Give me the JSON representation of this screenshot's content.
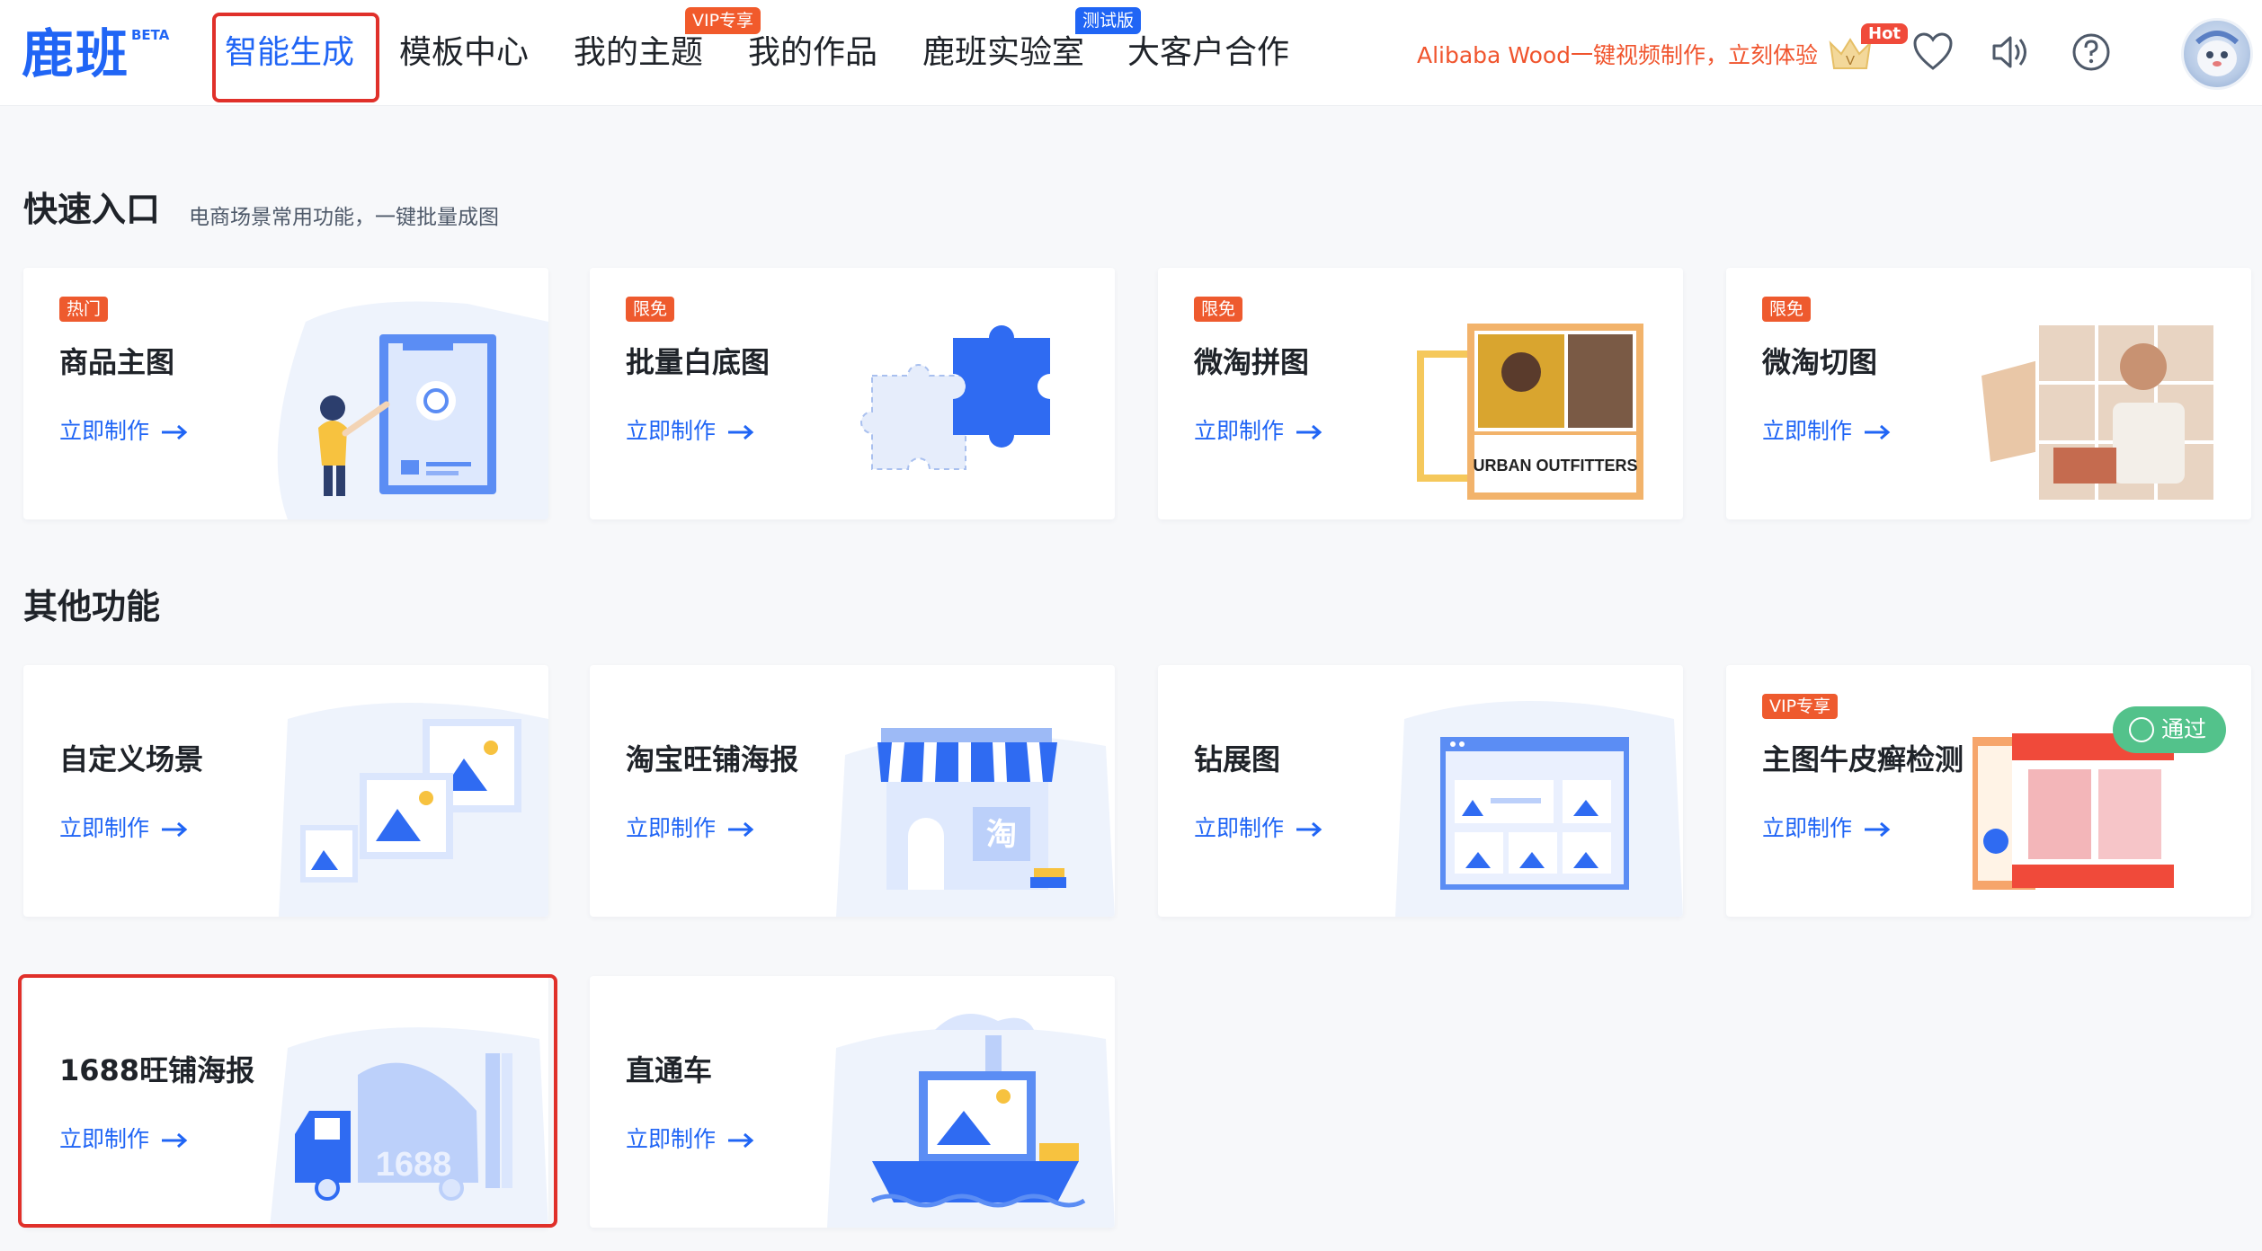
{
  "header": {
    "logo": "鹿班",
    "logo_badge": "BETA",
    "nav": [
      {
        "label": "智能生成",
        "active": true
      },
      {
        "label": "模板中心"
      },
      {
        "label": "我的主题",
        "badge": "VIP专享"
      },
      {
        "label": "我的作品"
      },
      {
        "label": "鹿班实验室",
        "badge": "测试版"
      },
      {
        "label": "大客户合作"
      }
    ],
    "promo": "Alibaba Wood一键视频制作，立刻体验",
    "hot_badge": "Hot",
    "vip_crown_letter": "V",
    "icons": [
      "vip-crown-icon",
      "heart-icon",
      "speaker-icon",
      "help-icon",
      "avatar"
    ]
  },
  "quick_entry": {
    "title": "快速入口",
    "subtitle": "电商场景常用功能，一键批量成图",
    "cards": [
      {
        "tag": "热门",
        "title": "商品主图",
        "link": "立即制作"
      },
      {
        "tag": "限免",
        "title": "批量白底图",
        "link": "立即制作"
      },
      {
        "tag": "限免",
        "title": "微淘拼图",
        "link": "立即制作",
        "image_text": "URBAN OUTFITTERS"
      },
      {
        "tag": "限免",
        "title": "微淘切图",
        "link": "立即制作"
      }
    ]
  },
  "other": {
    "title": "其他功能",
    "cards": [
      {
        "title": "自定义场景",
        "link": "立即制作"
      },
      {
        "title": "淘宝旺铺海报",
        "link": "立即制作",
        "image_text": "淘"
      },
      {
        "title": "钻展图",
        "link": "立即制作"
      },
      {
        "tag": "VIP专享",
        "title": "主图牛皮癣检测",
        "link": "立即制作",
        "status": "通过"
      },
      {
        "title": "1688旺铺海报",
        "link": "立即制作",
        "image_text": "1688"
      },
      {
        "title": "直通车",
        "link": "立即制作"
      }
    ]
  },
  "colors": {
    "brand": "#2065f5",
    "tag": "#ee5a2e",
    "highlight": "#e0302a",
    "pass": "#53c28b"
  }
}
